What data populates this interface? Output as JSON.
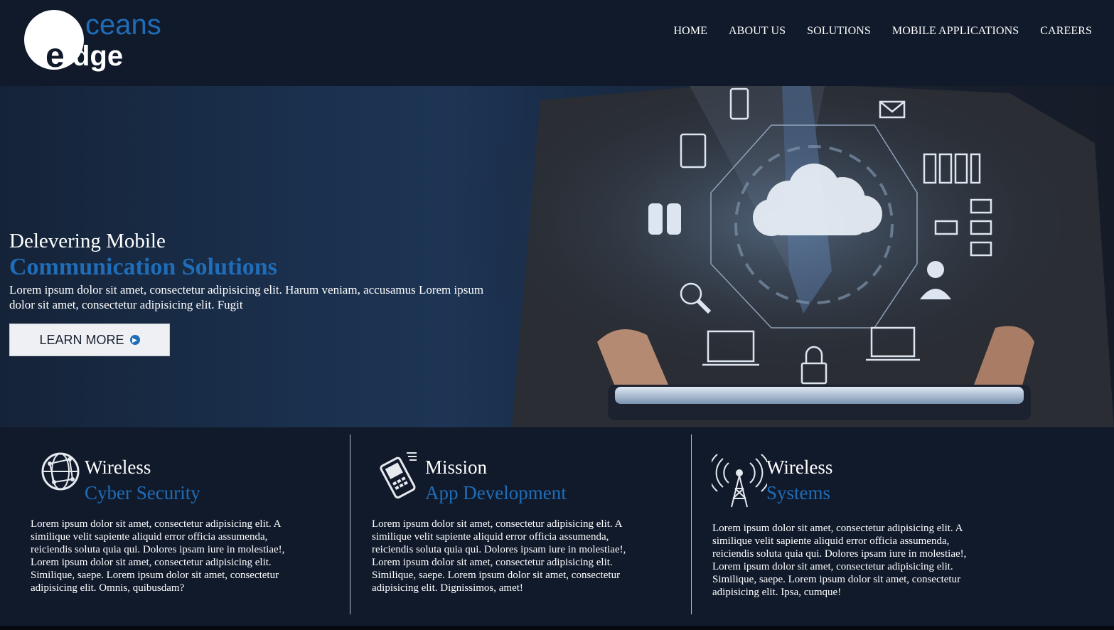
{
  "logo": {
    "top_text": "ceans",
    "bottom_text": "dge",
    "letter": "e"
  },
  "nav": {
    "items": [
      "HOME",
      "ABOUT US",
      "SOLUTIONS",
      "MOBILE APPLICATIONS",
      "CAREERS"
    ]
  },
  "hero": {
    "line1": "Delevering Mobile",
    "line2": "Communication Solutions",
    "description": "Lorem ipsum dolor sit amet, consectetur adipisicing elit. Harum veniam, accusamus Lorem ipsum dolor sit amet, consectetur adipisicing elit. Fugit",
    "button_label": "LEARN MORE",
    "button_icon": "chevron-right-circle-icon"
  },
  "features": [
    {
      "title": "Wireless",
      "subtitle": "Cyber Security",
      "icon": "globe-network-icon",
      "description": "Lorem ipsum dolor sit amet, consectetur adipisicing elit. A similique velit sapiente aliquid error officia assumenda, reiciendis soluta quia qui. Dolores ipsam iure in molestiae!, Lorem ipsum dolor sit amet, consectetur adipisicing elit. Similique, saepe. Lorem ipsum dolor sit amet, consectetur adipisicing elit. Omnis, quibusdam?"
    },
    {
      "title": "Mission",
      "subtitle": "App Development",
      "icon": "mobile-phone-icon",
      "description": "Lorem ipsum dolor sit amet, consectetur adipisicing elit. A similique velit sapiente aliquid error officia assumenda, reiciendis soluta quia qui. Dolores ipsam iure in molestiae!, Lorem ipsum dolor sit amet, consectetur adipisicing elit. Similique, saepe. Lorem ipsum dolor sit amet, consectetur adipisicing elit. Dignissimos, amet!"
    },
    {
      "title": "Wireless",
      "subtitle": "Systems",
      "icon": "antenna-tower-icon",
      "description": "Lorem ipsum dolor sit amet, consectetur adipisicing elit. A similique velit sapiente aliquid error officia assumenda, reiciendis soluta quia qui. Dolores ipsam iure in molestiae!, Lorem ipsum dolor sit amet, consectetur adipisicing elit. Similique, saepe. Lorem ipsum dolor sit amet, consectetur adipisicing elit. Ipsa, cumque!"
    }
  ],
  "colors": {
    "accent": "#1f6db8",
    "background": "#111a2b",
    "button_bg": "#eef0f3"
  }
}
